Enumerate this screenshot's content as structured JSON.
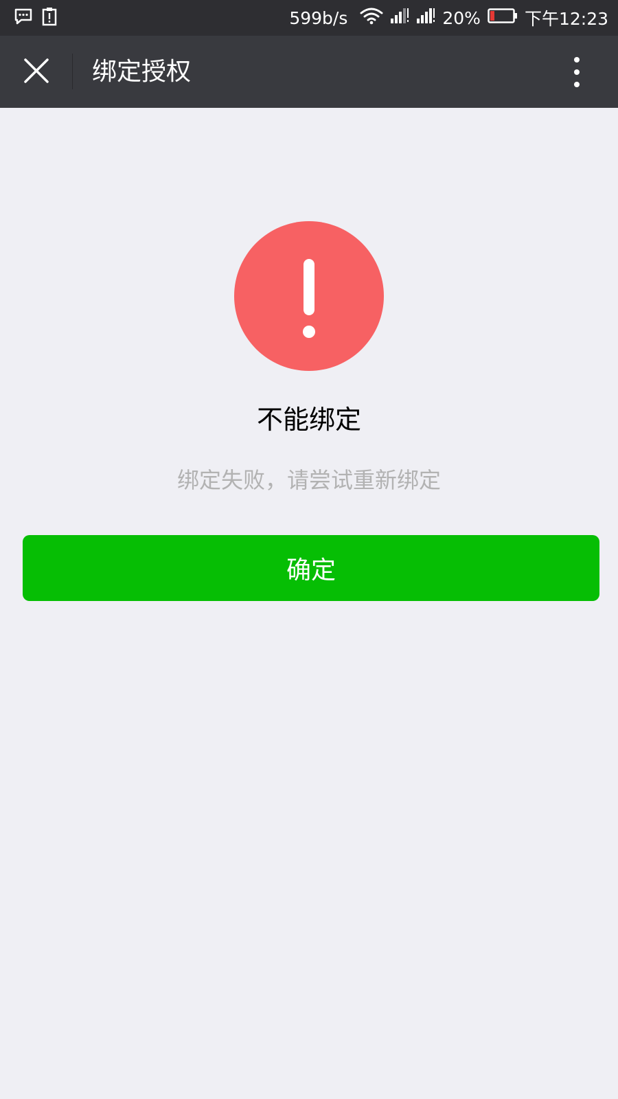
{
  "status_bar": {
    "net_speed": "599b/s",
    "battery_percent": "20%",
    "time": "下午12:23",
    "icons": [
      "message-icon",
      "alert-clipboard-icon",
      "wifi-icon",
      "signal-icon",
      "signal-icon",
      "battery-icon"
    ]
  },
  "nav": {
    "title": "绑定授权",
    "close_icon": "close-icon",
    "more_icon": "more-vertical-icon"
  },
  "content": {
    "icon": "exclamation-icon",
    "title": "不能绑定",
    "description": "绑定失败，请尝试重新绑定",
    "confirm_label": "确定"
  },
  "colors": {
    "status_bar_bg": "#2e2e32",
    "nav_bg": "#393a3f",
    "page_bg": "#efeff4",
    "alert_red": "#f76163",
    "button_green": "#06be04",
    "desc_gray": "#b2b2b2"
  }
}
